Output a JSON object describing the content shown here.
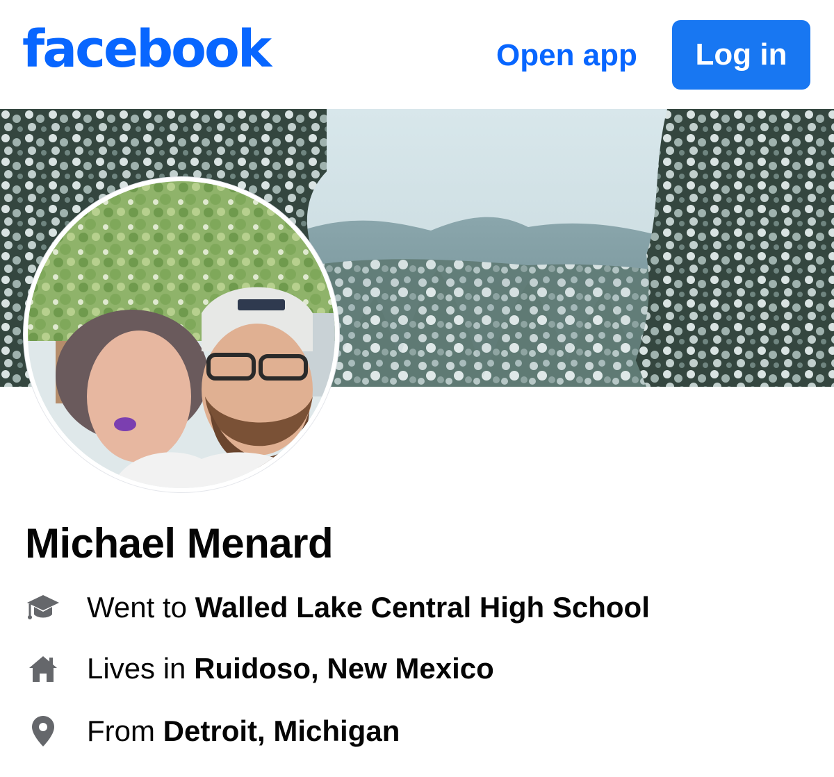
{
  "header": {
    "logo_text": "facebook",
    "open_app_label": "Open app",
    "login_label": "Log in"
  },
  "profile": {
    "name": "Michael Menard",
    "details": [
      {
        "icon": "graduation-cap-icon",
        "prefix": "Went to",
        "value": "Walled Lake Central High School"
      },
      {
        "icon": "home-icon",
        "prefix": "Lives in",
        "value": "Ruidoso, New Mexico"
      },
      {
        "icon": "location-pin-icon",
        "prefix": "From",
        "value": "Detroit, Michigan"
      }
    ]
  },
  "colors": {
    "brand_blue": "#0866ff",
    "button_blue": "#1877f2",
    "icon_gray": "#65676b",
    "text": "#050505"
  }
}
